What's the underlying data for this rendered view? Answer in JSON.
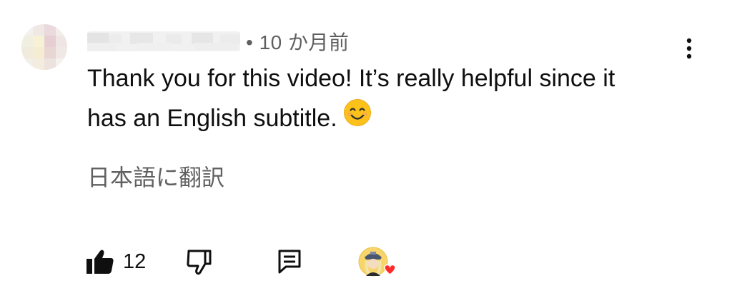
{
  "comment": {
    "time": "• 10 か月前",
    "text_line1": "Thank you for this video! It’s really helpful since it",
    "text_line2": "has an English subtitle.",
    "emoji": "smiling-face-emoji",
    "translate_label": "日本語に翻訳",
    "like_count": "12"
  },
  "icons": {
    "more": "more-vertical-icon",
    "like": "thumbs-up-icon",
    "dislike": "thumbs-down-icon",
    "reply": "reply-icon",
    "creator_heart": "creator-heart-icon"
  },
  "colors": {
    "text": "#0f0f0f",
    "secondary_text": "#606060",
    "heart": "#ff2a2a"
  }
}
